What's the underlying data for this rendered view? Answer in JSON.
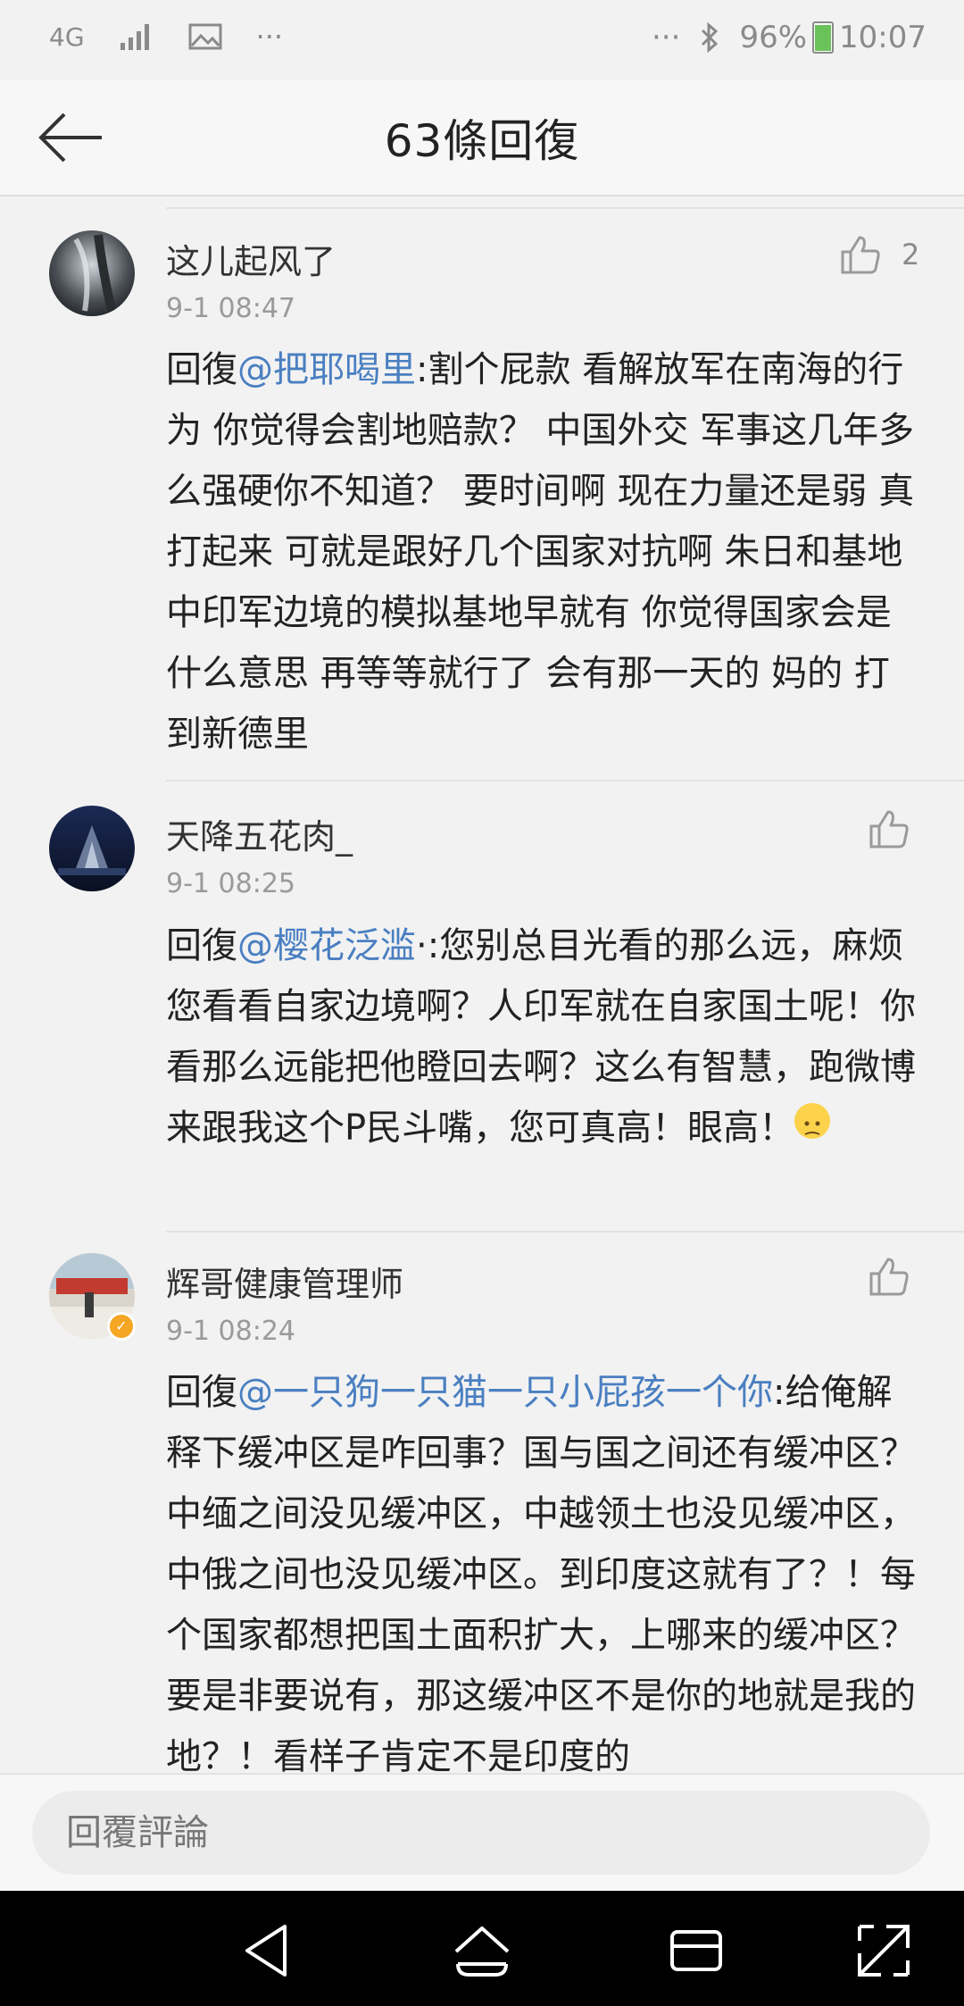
{
  "status_bar": {
    "network": "4G",
    "overflow": "···",
    "more": "···",
    "battery": "96%",
    "time": "10:07"
  },
  "header": {
    "title": "63條回復"
  },
  "comments": [
    {
      "username": "这儿起风了",
      "time": "9-1 08:47",
      "likes": "2",
      "reply_prefix": "回復",
      "mention": "@把耶喝里",
      "text": ":割个屁款 看解放军在南海的行为 你觉得会割地赔款？ 中国外交 军事这几年多么强硬你不知道？ 要时间啊 现在力量还是弱 真打起来 可就是跟好几个国家对抗啊 朱日和基地中印军边境的模拟基地早就有 你觉得国家会是什么意思 再等等就行了 会有那一天的 妈的 打到新德里"
    },
    {
      "username": "天降五花肉_",
      "time": "9-1 08:25",
      "likes": "",
      "reply_prefix": "回復",
      "mention": "@樱花泛滥",
      "text": "·:您别总目光看的那么远，麻烦您看看自家边境啊？人印军就在自家国土呢！你看那么远能把他瞪回去啊？这么有智慧，跑微博来跟我这个P民斗嘴，您可真高！眼高！"
    },
    {
      "username": "辉哥健康管理师",
      "time": "9-1 08:24",
      "likes": "",
      "reply_prefix": "回復",
      "mention": "@一只狗一只猫一只小屁孩一个你",
      "text": ":给俺解释下缓冲区是咋回事？国与国之间还有缓冲区？中缅之间没见缓冲区，中越领土也没见缓冲区，中俄之间也没见缓冲区。到印度这就有了？！每个国家都想把国土面积扩大，上哪来的缓冲区？要是非要说有，那这缓冲区不是你的地就是我的地？！看样子肯定不是印度的"
    }
  ],
  "reply_bar": {
    "placeholder": "回覆評論"
  },
  "icons": {
    "back": "arrow-left-icon",
    "like": "thumbs-up-icon",
    "nav_back": "triangle-back-icon",
    "nav_home": "home-icon",
    "nav_recent": "recent-apps-icon",
    "nav_expand": "expand-icon"
  },
  "colors": {
    "mention": "#4a7fc1",
    "background": "#f2f2f2",
    "nav_bar": "#000000"
  }
}
